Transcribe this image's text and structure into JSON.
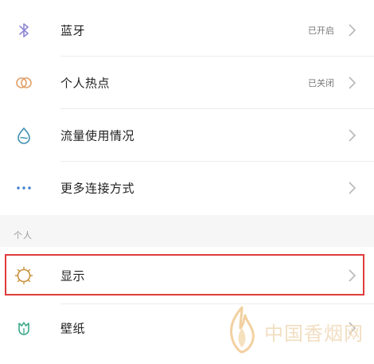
{
  "settings": {
    "rows": [
      {
        "label": "蓝牙",
        "status": "已开启",
        "icon": "bluetooth-icon"
      },
      {
        "label": "个人热点",
        "status": "已关闭",
        "icon": "hotspot-icon"
      },
      {
        "label": "流量使用情况",
        "status": "",
        "icon": "data-usage-icon"
      },
      {
        "label": "更多连接方式",
        "status": "",
        "icon": "more-connections-icon"
      }
    ],
    "section_personal": "个人",
    "personal_rows": [
      {
        "label": "显示",
        "icon": "display-icon"
      },
      {
        "label": "壁纸",
        "icon": "wallpaper-icon"
      }
    ]
  },
  "watermark": {
    "text": "中国香烟网"
  },
  "colors": {
    "highlight": "#e03c3c",
    "bluetooth": "#8e86d6",
    "hotspot": "#e0a06a",
    "data_usage": "#3d8fb0",
    "more": "#3d7fc9",
    "display": "#c8913a",
    "wallpaper": "#3aa88a"
  }
}
